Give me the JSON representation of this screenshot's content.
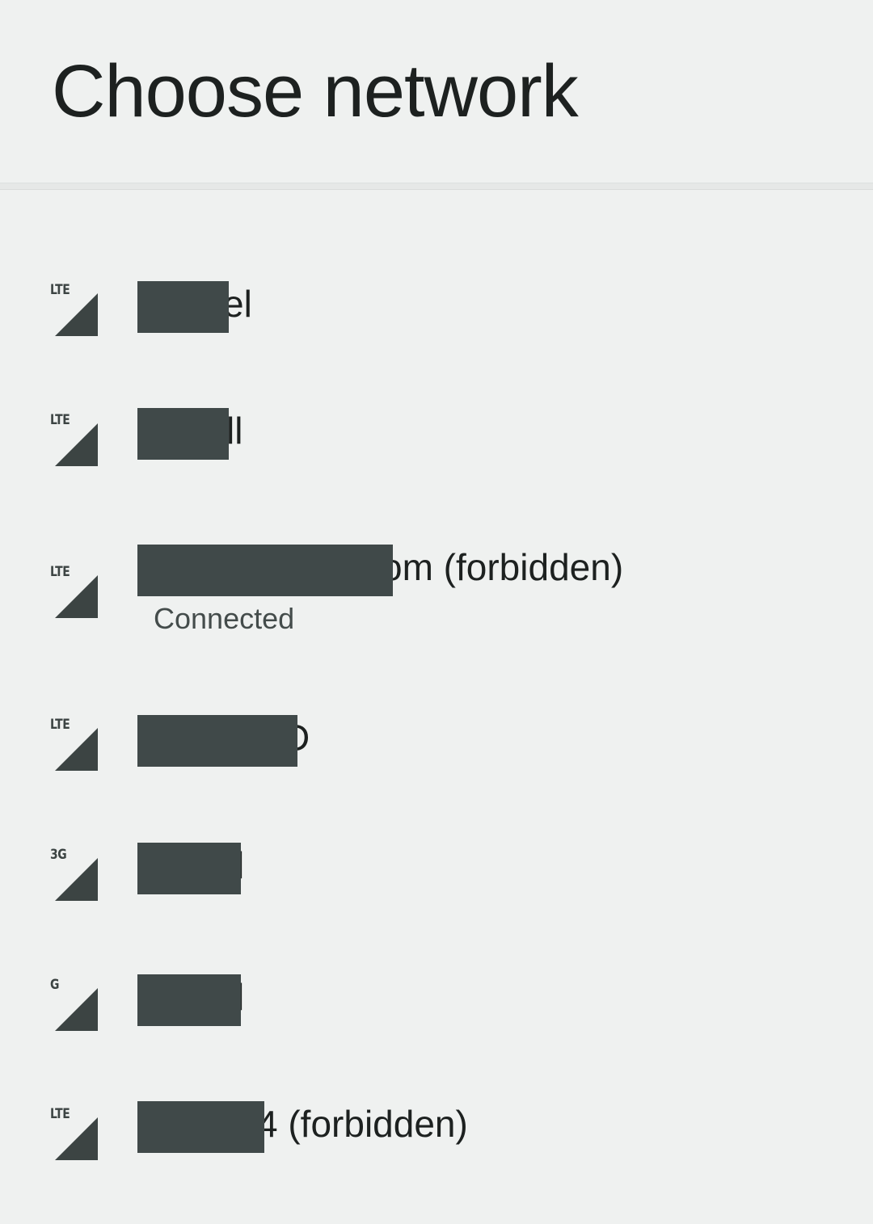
{
  "title": "Choose network",
  "networks": [
    {
      "tech": "LTE",
      "name": "el",
      "status": ""
    },
    {
      "tech": "LTE",
      "name": "ll",
      "status": ""
    },
    {
      "tech": "LTE",
      "name": "om (forbidden)",
      "status": "Connected"
    },
    {
      "tech": "LTE",
      "name": "D",
      "status": ""
    },
    {
      "tech": "3G",
      "name": "l",
      "status": ""
    },
    {
      "tech": "G",
      "name": "l",
      "status": ""
    },
    {
      "tech": "LTE",
      "name": "4 (forbidden)",
      "status": ""
    }
  ],
  "colors": {
    "background": "#eff1f0",
    "text": "#1d2120",
    "secondary_text": "#444c4b",
    "signal_icon": "#3c4443",
    "redaction": "#404949"
  }
}
